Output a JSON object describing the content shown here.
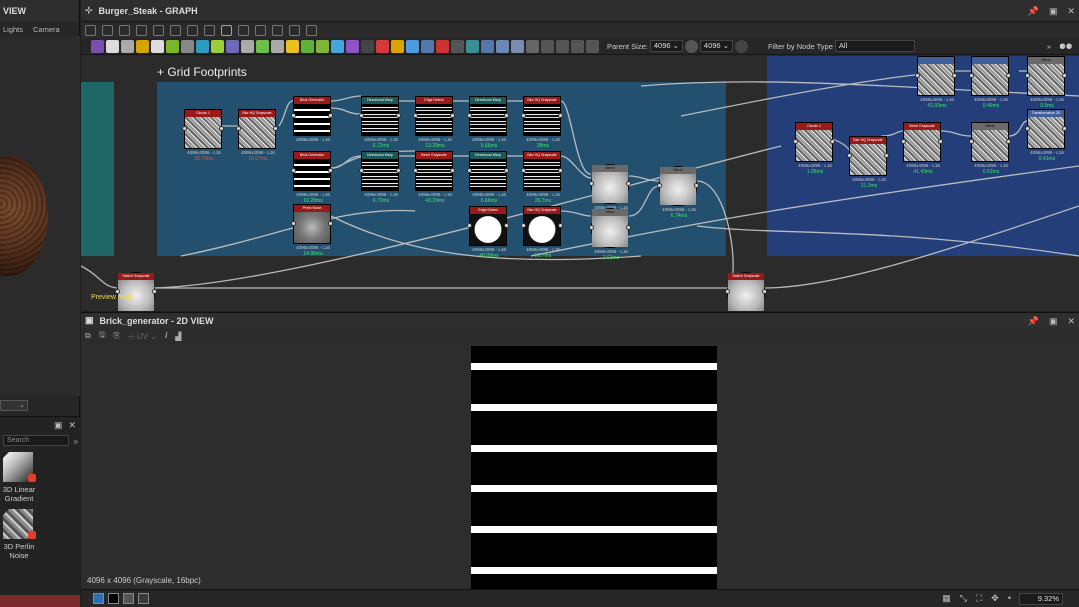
{
  "left_panel": {
    "title": "VIEW",
    "tabs": [
      "Lights",
      "Camera"
    ],
    "library": {
      "search_placeholder": "Search",
      "more": "»",
      "items": [
        {
          "label": "3D Linear Gradient"
        },
        {
          "label": "3D Perlin Noise"
        }
      ]
    }
  },
  "graph": {
    "title": "Burger_Steak - GRAPH",
    "parent_size_label": "Parent Size:",
    "parent_size_value": "4096",
    "second_size_value": "4096",
    "filter_label": "Filter by Node Type",
    "filter_value": "All",
    "frame_title": "+ Grid Footprints",
    "preview_note": "Preview node",
    "nodes": [
      {
        "id": "n1",
        "title": "Clouds 1",
        "fmt": "4096x4096 - L16",
        "time": "33.73ms",
        "time_red": true,
        "style": "noise",
        "header": "red"
      },
      {
        "id": "n2",
        "title": "Blur HQ Grayscale",
        "fmt": "4096x4096 - L16",
        "time": "10.07ms",
        "time_red": true,
        "style": "noise",
        "header": "red"
      },
      {
        "id": "n3",
        "title": "Brick Generator",
        "fmt": "4096x4096 - L16",
        "time": "",
        "time_red": false,
        "style": "stripes",
        "header": "red"
      },
      {
        "id": "n4",
        "title": "Directional Warp",
        "fmt": "4096x4096 - L16",
        "time": "6.72ms",
        "time_red": false,
        "style": "stripes-mess",
        "header": "teal"
      },
      {
        "id": "n5",
        "title": "Edge Detect",
        "fmt": "4096x4096 - L16",
        "time": "13.29ms",
        "time_red": false,
        "style": "stripes-mess",
        "header": "red"
      },
      {
        "id": "n6",
        "title": "Directional Warp",
        "fmt": "4096x4096 - L16",
        "time": "6.66ms",
        "time_red": false,
        "style": "stripes-mess",
        "header": "teal"
      },
      {
        "id": "n7",
        "title": "Blur HQ Grayscale",
        "fmt": "4096x4096 - L16",
        "time": "28ms",
        "time_red": false,
        "style": "stripes-mess",
        "header": "red"
      },
      {
        "id": "n8",
        "title": "Brick Generator",
        "fmt": "4096x4096 - L16",
        "time": "16.28ms",
        "time_red": false,
        "style": "stripes",
        "header": "red"
      },
      {
        "id": "n9",
        "title": "Directional Warp",
        "fmt": "4096x4096 - L16",
        "time": "6.72ms",
        "time_red": false,
        "style": "stripes-mess",
        "header": "teal"
      },
      {
        "id": "n10",
        "title": "Bevel Grayscale",
        "fmt": "4096x4096 - L16",
        "time": "43.29ms",
        "time_red": false,
        "style": "stripes-mess",
        "header": "red"
      },
      {
        "id": "n11",
        "title": "Directional Warp",
        "fmt": "4096x4096 - L16",
        "time": "6.66ms",
        "time_red": false,
        "style": "stripes-mess",
        "header": "teal"
      },
      {
        "id": "n12",
        "title": "Blur HQ Grayscale",
        "fmt": "4096x4096 - L16",
        "time": "26.7ms",
        "time_red": false,
        "style": "stripes-mess",
        "header": "red"
      },
      {
        "id": "n13",
        "title": "Blend",
        "fmt": "4096x4096 - L16",
        "time": "",
        "time_red": false,
        "style": "soft",
        "header": "gray",
        "round": true
      },
      {
        "id": "n14",
        "title": "Blend",
        "fmt": "4096x4096 - L16",
        "time": "6.74ms",
        "time_red": false,
        "style": "soft",
        "header": "gray",
        "round": true
      },
      {
        "id": "n15",
        "title": "Perlin Noise",
        "fmt": "4096x4096 - L16",
        "time": "14.96ms",
        "time_red": false,
        "style": "blur",
        "header": "red"
      },
      {
        "id": "n16",
        "title": "Edge Detect",
        "fmt": "4096x4096 - L16",
        "time": "48.09ms",
        "time_red": false,
        "style": "blob-w",
        "header": "red"
      },
      {
        "id": "n17",
        "title": "Blur HQ Grayscale",
        "fmt": "4096x4096 - L16",
        "time": "26.7ms",
        "time_red": false,
        "style": "blob-w",
        "header": "red"
      },
      {
        "id": "n18",
        "title": "Blend",
        "fmt": "4096x4096 - L16",
        "time": "3.63ms",
        "time_red": false,
        "style": "soft",
        "header": "gray",
        "round": true
      },
      {
        "id": "n19",
        "title": "Switch Grayscale",
        "fmt": "",
        "time": "",
        "time_red": false,
        "style": "soft",
        "header": "red",
        "round": true
      },
      {
        "id": "n20",
        "title": "Switch Grayscale",
        "fmt": "",
        "time": "",
        "time_red": false,
        "style": "soft",
        "header": "red",
        "round": true
      },
      {
        "id": "r1",
        "title": "Clouds 1",
        "fmt": "4096x4096 - L16",
        "time": "1.06ms",
        "time_red": false,
        "style": "noise",
        "header": "red"
      },
      {
        "id": "r2",
        "title": "Blur HQ Grayscale",
        "fmt": "4096x4096 - L16",
        "time": "31.3ms",
        "time_red": false,
        "style": "noise",
        "header": "red"
      },
      {
        "id": "r3",
        "title": "Bevel Grayscale",
        "fmt": "4096x4096 - L16",
        "time": "41.43ms",
        "time_red": false,
        "style": "noise",
        "header": "red"
      },
      {
        "id": "r4",
        "title": "Blend",
        "fmt": "4096x4096 - L16",
        "time": "0.62ms",
        "time_red": false,
        "style": "noise",
        "header": "gray"
      },
      {
        "id": "r5",
        "title": "Transformation 2D",
        "fmt": "4096x4096 - L16",
        "time": "0.41ms",
        "time_red": false,
        "style": "noise",
        "header": "blue"
      },
      {
        "id": "r6",
        "title": "",
        "fmt": "4096x4096 - L16",
        "time": "43.93ms",
        "time_red": false,
        "style": "noise",
        "header": "blue"
      },
      {
        "id": "r7",
        "title": "",
        "fmt": "4096x4096 - L16",
        "time": "0.46ms",
        "time_red": false,
        "style": "noise",
        "header": "blue"
      },
      {
        "id": "r8",
        "title": "Blend",
        "fmt": "4096x4096 - L16",
        "time": "0.5ms",
        "time_red": false,
        "style": "noise",
        "header": "gray"
      }
    ]
  },
  "view2d": {
    "title": "Brick_generator - 2D VIEW",
    "uv_label": "UV",
    "image_info": "4096 x 4096 (Grayscale, 16bpc)",
    "zoom": "9.32%",
    "stripe_count": 6
  },
  "colors": {
    "frame_blue": "#24506f",
    "frame_right": "#233e78",
    "frame_teal": "#1f6666",
    "node_red": "#9a1a1a",
    "timing_green": "#3de66a",
    "timing_red": "#e05050"
  }
}
